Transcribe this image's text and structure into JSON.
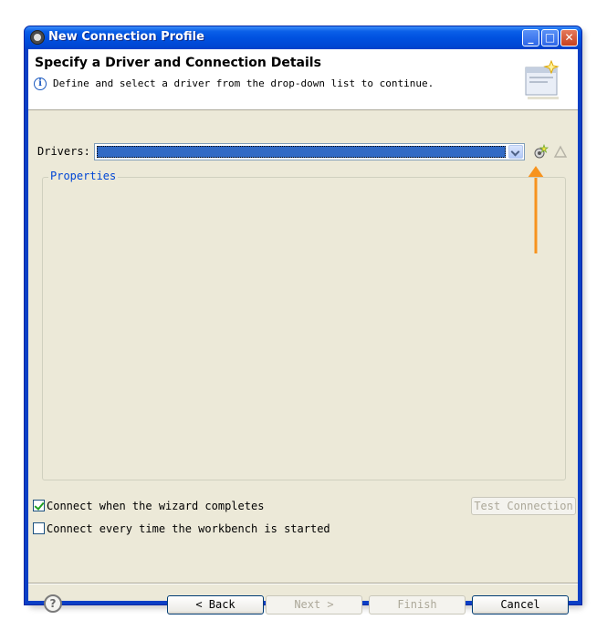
{
  "window": {
    "title": "New Connection Profile",
    "minimize": "_",
    "maximize": "□",
    "close": "✕"
  },
  "banner": {
    "title": "Specify a Driver and Connection Details",
    "description": "Define and select a driver from the drop-down list to continue.",
    "info_icon": "i"
  },
  "drivers": {
    "label": "Drivers:",
    "selected_value": "",
    "new_driver_icon": "new-driver-icon",
    "edit_driver_icon": "edit-driver-icon"
  },
  "properties": {
    "legend": "Properties"
  },
  "options": {
    "connect_on_complete": {
      "label": "Connect when the wizard completes",
      "checked": true
    },
    "connect_every_time": {
      "label": "Connect every time the workbench is started",
      "checked": false
    }
  },
  "test_connection": {
    "label": "Test Connection",
    "enabled": false
  },
  "footer": {
    "help": "?",
    "back": "< Back",
    "next": "Next >",
    "finish": "Finish",
    "cancel": "Cancel"
  },
  "colors": {
    "title_bar": "#0054e3",
    "selection": "#316ac5",
    "annotation_arrow": "#f7931e",
    "dialog_bg": "#ece9d8"
  }
}
